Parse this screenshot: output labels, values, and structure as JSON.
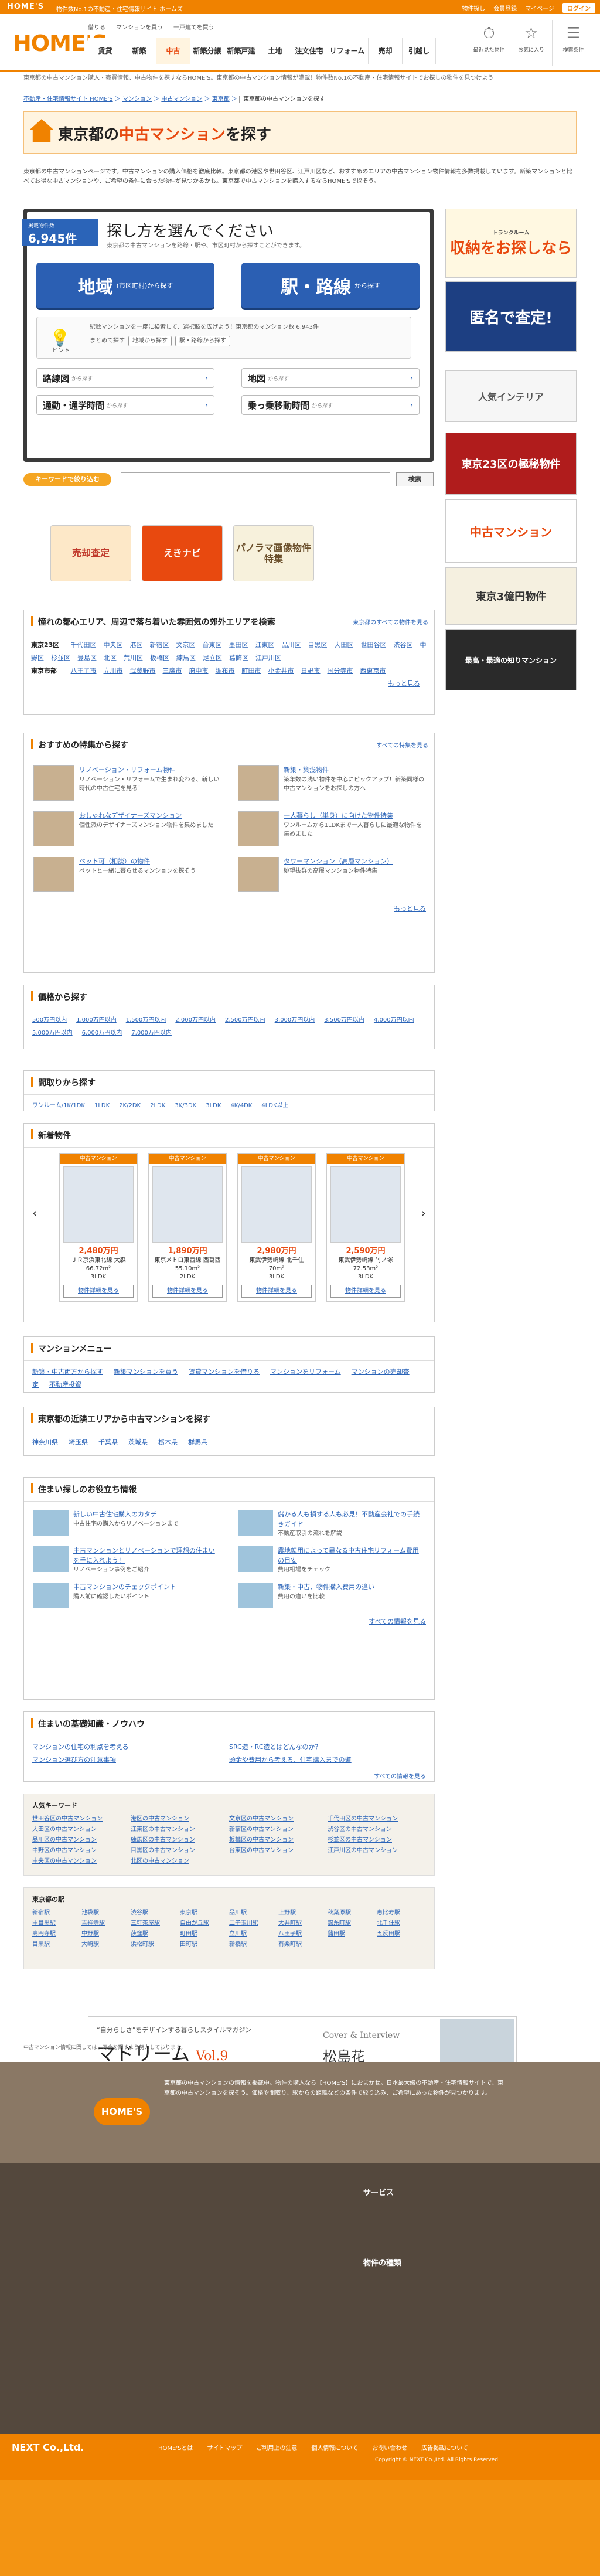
{
  "topbar": {
    "logo": "HOME'S",
    "tagline": "物件数No.1の不動産・住宅情報サイト ホームズ",
    "links": [
      "物件探し",
      "会員登録",
      "マイページ"
    ],
    "login": "ログイン"
  },
  "header": {
    "logo": "HOME'S",
    "row1": [
      "借りる",
      "マンションを買う",
      "一戸建てを買う"
    ],
    "nav": [
      "賃貸",
      "新築",
      "中古",
      "新築分譲",
      "新築戸建",
      "土地",
      "注文住宅",
      "リフォーム",
      "売却",
      "引越し"
    ],
    "icons": [
      {
        "label": "最近見た物件",
        "icon": "clock-icon"
      },
      {
        "label": "お気に入り",
        "icon": "star-icon"
      },
      {
        "label": "検索条件",
        "icon": "list-icon"
      }
    ]
  },
  "breadcrumb_text": "東京都の中古マンション購入・売買情報、中古物件を探すならHOME'S。東京都の中古マンション情報が満載！物件数No.1の不動産・住宅情報サイトでお探しの物件を見つけよう",
  "breadcrumb": [
    "不動産・住宅情報サイト HOME'S",
    "マンション",
    "中古マンション",
    "東京都"
  ],
  "breadcrumb_current": "東京都の中古マンションを探す",
  "title_pre": "東京都の",
  "title_em": "中古マンション",
  "title_post": "を探す",
  "intro": "東京都の中古マンションページです。中古マンションの購入価格を徹底比較。東京都の港区や世田谷区、江戸川区など、おすすめのエリアの中古マンション物件情報を多数掲載しています。新築マンションと比べてお得な中古マンションや、ご希望の条件に合った物件が見つかるかも。東京都で中古マンションを購入するならHOME'Sで探そう。",
  "search": {
    "count_label": "掲載物件数",
    "count": "6,945件",
    "heading": "探し方を選んでください",
    "sub": "東京都の中古マンションを路線・駅や、市区町村から探すことができます。",
    "btn_area": "地域",
    "btn_area_sub": "(市区町村)から探す",
    "btn_station": "駅・路線",
    "btn_station_sub": "から探す",
    "hint_label": "ヒント",
    "hint_text": "駅数マンションを一度に検索して、選択肢を広げよう！東京都のマンション数 6,943件",
    "hint_text2": "まとめて探す",
    "hint_btn1": "地域から探す",
    "hint_btn2": "駅・路線から探す",
    "opt1": "路線図",
    "opt1_sub": "から探す",
    "opt2": "地図",
    "opt2_sub": "から探す",
    "opt3": "通勤・通学時間",
    "opt3_sub": "から探す",
    "opt4": "乗っ乗移動時間",
    "opt4_sub": "から探す"
  },
  "keyword": {
    "label": "キーワードで絞り込む",
    "placeholder": "",
    "button": "検索"
  },
  "banners": [
    "売却査定",
    "えきナビ",
    "パノラマ画像物件特集"
  ],
  "side": {
    "top_label": "トランクルーム",
    "b1": "収納をお探しなら",
    "b2": "匿名で査定!",
    "b3": "人気インテリア",
    "b4": "東京23区の極秘物件",
    "b5": "中古マンション",
    "b6": "東京3億円物件",
    "b7": "最高・最適の知りマンション"
  },
  "areas": {
    "title": "憧れの都心エリア、周辺で落ち着いた雰囲気の郊外エリアを検索",
    "more": "東京都のすべての物件を見る",
    "row1_label": "東京23区",
    "row1": [
      "千代田区",
      "中央区",
      "港区",
      "新宿区",
      "文京区",
      "台東区",
      "墨田区",
      "江東区",
      "品川区",
      "目黒区",
      "大田区",
      "世田谷区",
      "渋谷区",
      "中野区",
      "杉並区",
      "豊島区",
      "北区",
      "荒川区",
      "板橋区",
      "練馬区",
      "足立区",
      "葛飾区",
      "江戸川区"
    ],
    "row2_label": "東京市部",
    "row2": [
      "八王子市",
      "立川市",
      "武蔵野市",
      "三鷹市",
      "府中市",
      "調布市",
      "町田市",
      "小金井市",
      "日野市",
      "国分寺市",
      "西東京市"
    ],
    "more2": "もっと見る"
  },
  "features": {
    "title": "おすすめの特集から探す",
    "more": "すべての特集を見る",
    "items": [
      {
        "t": "リノベーション・リフォーム物件",
        "d": "リノベーション・リフォームで生まれ変わる、新しい時代の中古住宅を見る！"
      },
      {
        "t": "新築・築浅物件",
        "d": "築年数の浅い物件を中心にピックアップ！新築同様の中古マンションをお探しの方へ"
      },
      {
        "t": "おしゃれなデザイナーズマンション",
        "d": "個性派のデザイナーズマンション物件を集めました"
      },
      {
        "t": "一人暮らし（単身）に向けた物件特集",
        "d": "ワンルームから1LDKまで一人暮らしに最適な物件を集めました"
      },
      {
        "t": "ペット可（相談）の物件",
        "d": "ペットと一緒に暮らせるマンションを探そう"
      },
      {
        "t": "タワーマンション（高層マンション）",
        "d": "眺望抜群の高層マンション物件特集"
      }
    ],
    "more2": "もっと見る"
  },
  "price": {
    "title": "価格から探す",
    "items": [
      "500万円以内",
      "1,000万円以内",
      "1,500万円以内",
      "2,000万円以内",
      "2,500万円以内",
      "3,000万円以内",
      "3,500万円以内",
      "4,000万円以内",
      "5,000万円以内",
      "6,000万円以内",
      "7,000万円以内"
    ]
  },
  "madori": {
    "title": "間取りから探す",
    "items": [
      "ワンルーム/1K/1DK",
      "1LDK",
      "2K/2DK",
      "2LDK",
      "3K/3DK",
      "3LDK",
      "4K/4DK",
      "4LDK以上"
    ]
  },
  "newprops": {
    "title": "新着物件",
    "items": [
      {
        "tag": "中古マンション",
        "price": "2,480万円",
        "loc": "ＪＲ京浜東北線 大森",
        "area": "66.72m²",
        "plan": "3LDK",
        "link": "物件詳細を見る"
      },
      {
        "tag": "中古マンション",
        "price": "1,890万円",
        "loc": "東京メトロ東西線 西葛西",
        "area": "55.10m²",
        "plan": "2LDK",
        "link": "物件詳細を見る"
      },
      {
        "tag": "中古マンション",
        "price": "2,980万円",
        "loc": "東武伊勢崎線 北千住",
        "area": "70m²",
        "plan": "3LDK",
        "link": "物件詳細を見る"
      },
      {
        "tag": "中古マンション",
        "price": "2,590万円",
        "loc": "東武伊勢崎線 竹ノ塚",
        "area": "72.53m²",
        "plan": "3LDK",
        "link": "物件詳細を見る"
      }
    ]
  },
  "menu": {
    "title": "マンションメニュー",
    "items": [
      "新築・中古両方から探す",
      "新築マンションを買う",
      "賃貸マンションを借りる",
      "マンションをリフォーム",
      "マンションの売却査定",
      "不動産投資"
    ]
  },
  "nearby": {
    "title": "東京都の近隣エリアから中古マンションを探す",
    "items": [
      "神奈川県",
      "埼玉県",
      "千葉県",
      "茨城県",
      "栃木県",
      "群馬県"
    ]
  },
  "useful": {
    "title": "住まい探しのお役立ち情報",
    "items": [
      {
        "t": "新しい中古住宅購入のカタチ",
        "d": "中古住宅の購入からリノベーションまで"
      },
      {
        "t": "儲かる人も損する人も必見！不動産会社での手続きガイド",
        "d": "不動産取引の流れを解説"
      },
      {
        "t": "中古マンションとリノベーションで理想の住まいを手に入れよう！",
        "d": "リノベーション事例をご紹介"
      },
      {
        "t": "農地転用によって異なる中古住宅リフォーム費用の目安",
        "d": "費用相場をチェック"
      },
      {
        "t": "中古マンションのチェックポイント",
        "d": "購入前に確認したいポイント"
      },
      {
        "t": "新築・中古、物件購入費用の違い",
        "d": "費用の違いを比較"
      }
    ],
    "more": "すべての情報を見る"
  },
  "knowhow": {
    "title": "住まいの基礎知識・ノウハウ",
    "items": [
      "マンションの住宅の利点を考える",
      "SRC造・RC造とはどんなのか？",
      "マンション選び方の注意事項",
      "頭金や費用から考える、住宅購入までの道"
    ],
    "more": "すべての情報を見る"
  },
  "popular_kw": {
    "title": "人気キーワード",
    "items": [
      "世田谷区の中古マンション",
      "港区の中古マンション",
      "文京区の中古マンション",
      "千代田区の中古マンション",
      "大田区の中古マンション",
      "江東区の中古マンション",
      "新宿区の中古マンション",
      "渋谷区の中古マンション",
      "品川区の中古マンション",
      "練馬区の中古マンション",
      "板橋区の中古マンション",
      "杉並区の中古マンション",
      "中野区の中古マンション",
      "目黒区の中古マンション",
      "台東区の中古マンション",
      "江戸川区の中古マンション",
      "中央区の中古マンション",
      "北区の中古マンション"
    ]
  },
  "stations": {
    "title": "東京都の駅",
    "items": [
      "新宿駅",
      "池袋駅",
      "渋谷駅",
      "東京駅",
      "品川駅",
      "上野駅",
      "秋葉原駅",
      "恵比寿駅",
      "中目黒駅",
      "吉祥寺駅",
      "三軒茶屋駅",
      "自由が丘駅",
      "二子玉川駅",
      "大井町駅",
      "錦糸町駅",
      "北千住駅",
      "高円寺駅",
      "中野駅",
      "荻窪駅",
      "町田駅",
      "立川駅",
      "八王子駅",
      "蒲田駅",
      "五反田駅",
      "目黒駅",
      "大崎駅",
      "浜松町駅",
      "田町駅",
      "新橋駅",
      "有楽町駅"
    ]
  },
  "ad": {
    "left": "“自分らしさ”をデザインする暮らしスタイルマガジン",
    "title": "マドリーム",
    "vol": "Vol.9",
    "cover": "Cover & Interview",
    "name": "松島花"
  },
  "note": "中古マンション情報に関しては、万全を期すよう努力しております。",
  "footer": {
    "logo": "HOME'S",
    "desc": "東京都の中古マンションの情報を掲載中。物件の購入なら【HOME'S】におまかせ。日本最大級の不動産・住宅情報サイトで、東京都の中古マンションを探そう。価格や間取り、駅からの距離などの条件で絞り込み、ご希望にあった物件が見つかります。",
    "service_title": "サービス",
    "kind_title": "物件の種類",
    "bottom_links": [
      "HOME'Sとは",
      "サイトマップ",
      "ご利用上の注意",
      "個人情報について",
      "お問い合わせ",
      "広告掲載について"
    ],
    "company": "NEXT Co.,Ltd.",
    "copyright": "Copyright © NEXT Co.,Ltd. All Rights Reserved."
  },
  "colors": {
    "brand": "#f08200",
    "link": "#2b64b8",
    "footer": "#54483d"
  }
}
